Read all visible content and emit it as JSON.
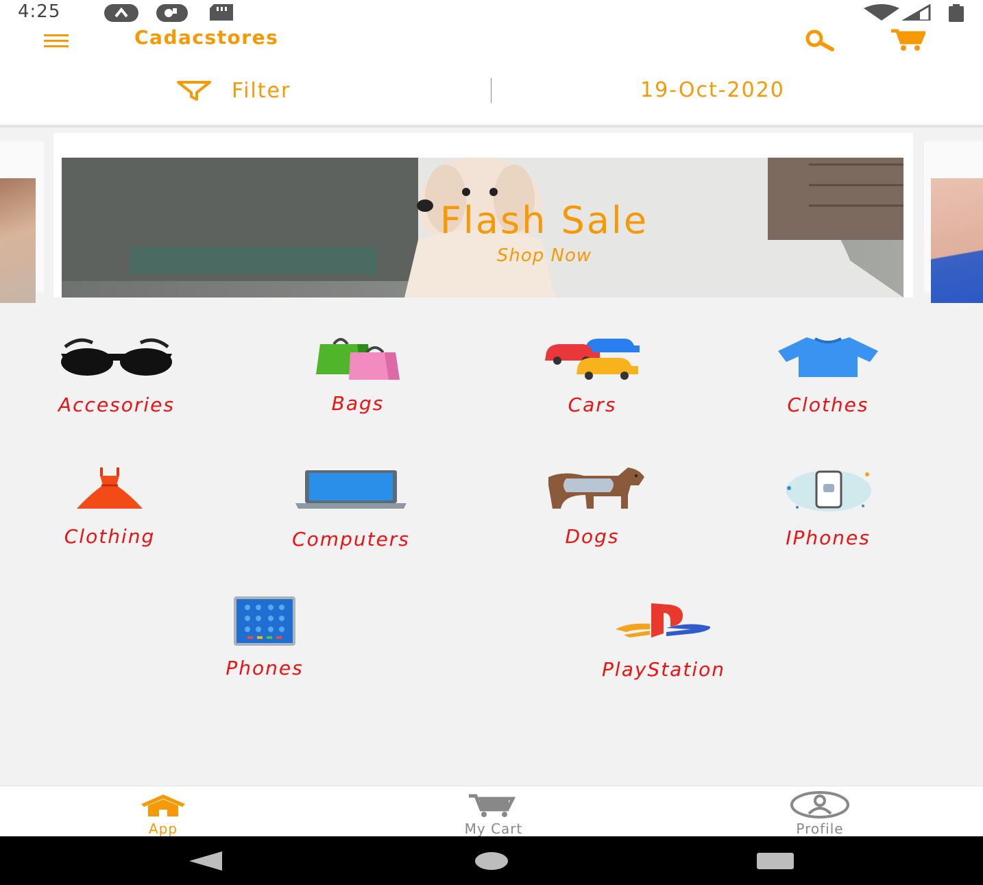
{
  "status_bar": {
    "time": "4:25"
  },
  "app_bar": {
    "title": "Cadacstores",
    "filter_label": "Filter",
    "date": "19-Oct-2020"
  },
  "banner": {
    "title": "Flash Sale",
    "subtitle": "Shop Now"
  },
  "categories": [
    {
      "label": "Accesories",
      "icon": "sunglasses-icon"
    },
    {
      "label": "Bags",
      "icon": "shopping-bags-icon"
    },
    {
      "label": "Cars",
      "icon": "cars-icon"
    },
    {
      "label": "Clothes",
      "icon": "tshirt-icon"
    },
    {
      "label": "Clothing",
      "icon": "dress-icon"
    },
    {
      "label": "Computers",
      "icon": "laptop-icon"
    },
    {
      "label": "Dogs",
      "icon": "dog-icon"
    },
    {
      "label": "IPhones",
      "icon": "iphone-icon"
    },
    {
      "label": "Phones",
      "icon": "tablet-phone-icon"
    },
    {
      "label": "PlayStation",
      "icon": "playstation-logo-icon"
    }
  ],
  "bottom_nav": {
    "items": [
      {
        "label": "App",
        "icon": "home-icon",
        "active": true
      },
      {
        "label": "My Cart",
        "icon": "cart-icon",
        "active": false
      },
      {
        "label": "Profile",
        "icon": "profile-icon",
        "active": false
      }
    ]
  },
  "colors": {
    "accent": "#f59a06",
    "category_label": "#ee1111",
    "inactive_nav": "#888888",
    "background": "#f2f2f2"
  }
}
